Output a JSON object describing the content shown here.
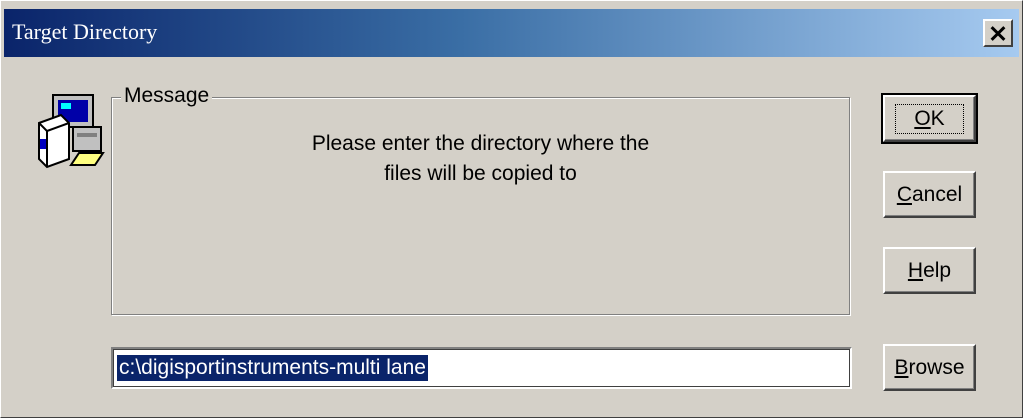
{
  "window": {
    "title": "Target Directory"
  },
  "icons": {
    "app": "installer-computer-icon",
    "close": "close-icon"
  },
  "message_group": {
    "label": "Message",
    "line1": "Please enter the directory where the",
    "line2": "files will be copied to"
  },
  "path_input": {
    "value": "c:\\digisportinstruments-multi lane"
  },
  "buttons": {
    "ok": {
      "mnemonic": "O",
      "rest": "K"
    },
    "cancel": {
      "mnemonic": "C",
      "rest": "ancel"
    },
    "help": {
      "mnemonic": "H",
      "rest": "elp"
    },
    "browse": {
      "mnemonic": "B",
      "rest": "rowse"
    }
  },
  "colors": {
    "titlebar_start": "#0a246a",
    "titlebar_end": "#a6caf0",
    "face": "#d4d0c8",
    "selection": "#0a246a"
  }
}
